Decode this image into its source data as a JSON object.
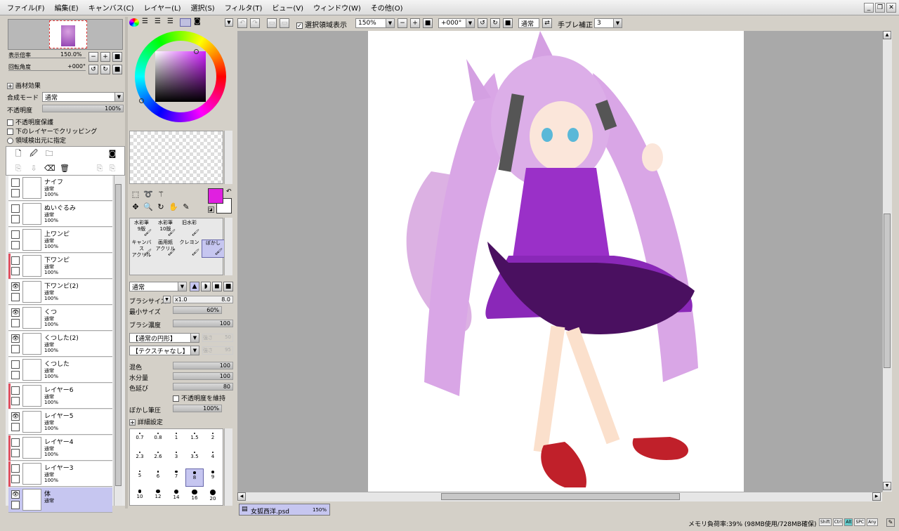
{
  "menu": [
    "ファイル(F)",
    "編集(E)",
    "キャンバス(C)",
    "レイヤー(L)",
    "選択(S)",
    "フィルタ(T)",
    "ビュー(V)",
    "ウィンドウ(W)",
    "その他(O)"
  ],
  "navigator": {
    "zoom_label": "表示倍率",
    "zoom_value": "150.0%",
    "rotate_label": "回転角度",
    "rotate_value": "+000°"
  },
  "layer_props": {
    "effect_label": "画材効果",
    "blend_label": "合成モード",
    "blend_value": "通常",
    "opacity_label": "不透明度",
    "opacity_value": "100%",
    "protect": "不透明度保護",
    "clip": "下のレイヤーでクリッピング",
    "select_src": "領域検出元に指定"
  },
  "layers": [
    {
      "name": "ナイフ",
      "mode": "通常",
      "opacity": "100%",
      "visible": false,
      "marked": false
    },
    {
      "name": "ぬいぐるみ",
      "mode": "通常",
      "opacity": "100%",
      "visible": false,
      "marked": false
    },
    {
      "name": "上ワンピ",
      "mode": "通常",
      "opacity": "100%",
      "visible": false,
      "marked": false
    },
    {
      "name": "下ワンピ",
      "mode": "通常",
      "opacity": "100%",
      "visible": false,
      "marked": true
    },
    {
      "name": "下ワンピ(2)",
      "mode": "通常",
      "opacity": "100%",
      "visible": true,
      "marked": false
    },
    {
      "name": "くつ",
      "mode": "通常",
      "opacity": "100%",
      "visible": true,
      "marked": false
    },
    {
      "name": "くつした(2)",
      "mode": "通常",
      "opacity": "100%",
      "visible": true,
      "marked": false
    },
    {
      "name": "くつした",
      "mode": "通常",
      "opacity": "100%",
      "visible": false,
      "marked": false
    },
    {
      "name": "レイヤー6",
      "mode": "通常",
      "opacity": "100%",
      "visible": false,
      "marked": true
    },
    {
      "name": "レイヤー5",
      "mode": "通常",
      "opacity": "100%",
      "visible": true,
      "marked": false
    },
    {
      "name": "レイヤー4",
      "mode": "通常",
      "opacity": "100%",
      "visible": false,
      "marked": true
    },
    {
      "name": "レイヤー3",
      "mode": "通常",
      "opacity": "100%",
      "visible": false,
      "marked": true
    },
    {
      "name": "体",
      "mode": "通常",
      "opacity": "",
      "visible": true,
      "marked": false
    }
  ],
  "colors": {
    "primary": "#e020e0",
    "secondary": "#ffffff",
    "accent_select": "#c6c6f0",
    "mark": "#e05060"
  },
  "brushes": {
    "row1": [
      "水彩筆\n9版",
      "水彩筆\n10版",
      "旧水彩",
      ""
    ],
    "row2": [
      "キャンバス\nアクリル",
      "画用紙\nアクリル",
      "クレヨン",
      "ぼかし"
    ]
  },
  "brush_settings": {
    "mode": "通常",
    "size_label": "ブラシサイズ",
    "size_mult": "x1.0",
    "size_value": "8.0",
    "min_size_label": "最小サイズ",
    "min_size_value": "60%",
    "density_label": "ブラシ濃度",
    "density_value": "100",
    "shape": "【通常の円形】",
    "shape_strength": "強さ",
    "shape_strength_val": "50",
    "texture": "【テクスチャなし】",
    "tex_strength": "強さ",
    "tex_strength_val": "95",
    "mix_label": "混色",
    "mix_value": "100",
    "water_label": "水分量",
    "water_value": "100",
    "stretch_label": "色延び",
    "stretch_value": "80",
    "keep_opacity": "不透明度を維持",
    "blur_label": "ぼかし筆圧",
    "blur_value": "100%",
    "detail": "詳細設定"
  },
  "size_grid": [
    "0.7",
    "0.8",
    "1",
    "1.5",
    "2",
    "2.3",
    "2.6",
    "3",
    "3.5",
    "4",
    "5",
    "6",
    "7",
    "8",
    "9",
    "10",
    "12",
    "14",
    "16",
    "20"
  ],
  "toolbar": {
    "sel_show": "選択領域表示",
    "zoom": "150%",
    "angle": "+000°",
    "mode": "通常",
    "stab_label": "手ブレ補正",
    "stab_value": "3"
  },
  "tab": {
    "name": "女狐西洋.psd",
    "zoom": "150%"
  },
  "status": {
    "memory": "メモリ負荷率:39% (98MB使用/728MB確保)",
    "keys": [
      "Shift",
      "Ctrl",
      "Alt",
      "SPC",
      "Any"
    ]
  }
}
